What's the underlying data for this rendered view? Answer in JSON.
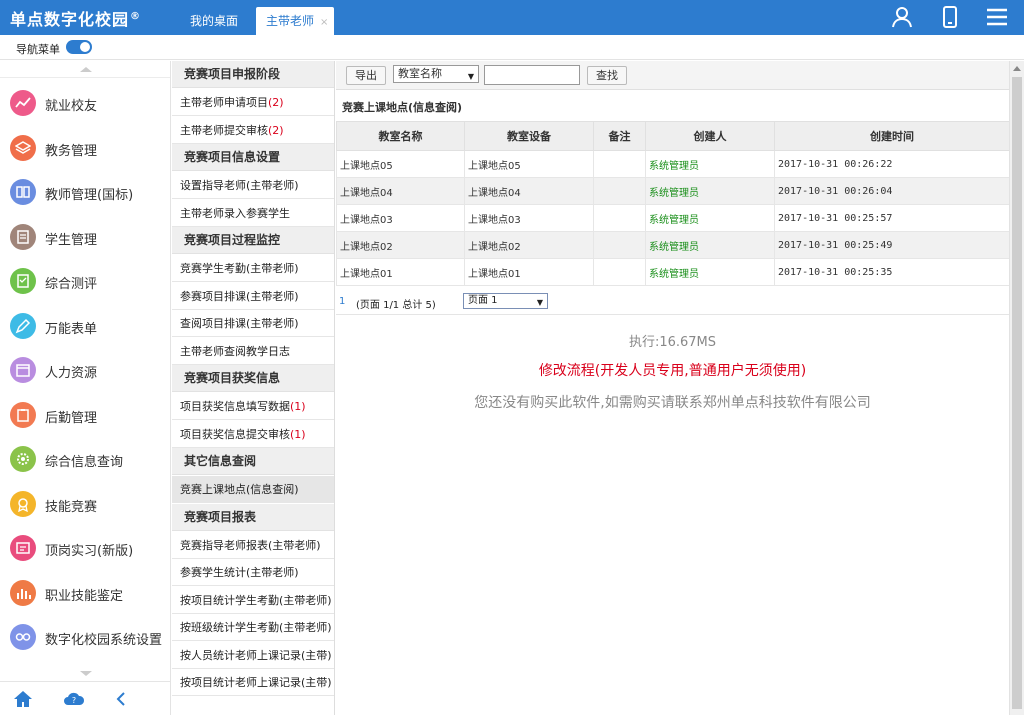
{
  "app": {
    "title": "单点数字化校园",
    "reg_mark": "®"
  },
  "tabs": [
    {
      "label": "我的桌面"
    },
    {
      "label": "主带老师",
      "close": "×"
    }
  ],
  "nav_toggle": {
    "label": "导航菜单",
    "state": "on"
  },
  "sidebar": {
    "items": [
      {
        "label": "就业校友",
        "icon": "trend-line-icon",
        "color": "#ee5a8a"
      },
      {
        "label": "教务管理",
        "icon": "layers-icon",
        "color": "#f06e4a"
      },
      {
        "label": "教师管理(国标)",
        "icon": "book-icon",
        "color": "#6a8de0"
      },
      {
        "label": "学生管理",
        "icon": "document-list-icon",
        "color": "#a0857a"
      },
      {
        "label": "综合测评",
        "icon": "checklist-icon",
        "color": "#6ec24a"
      },
      {
        "label": "万能表单",
        "icon": "form-edit-icon",
        "color": "#3ebbe6"
      },
      {
        "label": "人力资源",
        "icon": "calendar-icon",
        "color": "#b98de0"
      },
      {
        "label": "后勤管理",
        "icon": "clipboard-icon",
        "color": "#f27a52"
      },
      {
        "label": "综合信息查询",
        "icon": "gear-icon",
        "color": "#8bc34a"
      },
      {
        "label": "技能竞赛",
        "icon": "badge-icon",
        "color": "#f4b52a"
      },
      {
        "label": "顶岗实习(新版)",
        "icon": "id-card-icon",
        "color": "#e94c7d"
      },
      {
        "label": "职业技能鉴定",
        "icon": "bar-chart-icon",
        "color": "#ef7a45"
      },
      {
        "label": "数字化校园系统设置",
        "icon": "glasses-icon",
        "color": "#7f93e8"
      }
    ],
    "bottom": {
      "home_icon": "home-icon",
      "cloud_icon": "cloud-help-icon",
      "collapse_icon": "chevron-left-icon"
    }
  },
  "submenu": {
    "groups": [
      {
        "title": "竞赛项目申报阶段",
        "items": [
          {
            "label": "主带老师申请项目",
            "count": "(2)"
          },
          {
            "label": "主带老师提交审核",
            "count": "(2)"
          }
        ]
      },
      {
        "title": "竞赛项目信息设置",
        "items": [
          {
            "label": "设置指导老师(主带老师)"
          },
          {
            "label": "主带老师录入参赛学生"
          }
        ]
      },
      {
        "title": "竞赛项目过程监控",
        "items": [
          {
            "label": "竞赛学生考勤(主带老师)"
          },
          {
            "label": "参赛项目排课(主带老师)"
          },
          {
            "label": "查阅项目排课(主带老师)"
          },
          {
            "label": "主带老师查阅教学日志"
          }
        ]
      },
      {
        "title": "竞赛项目获奖信息",
        "items": [
          {
            "label": "项目获奖信息填写数据",
            "count": "(1)"
          },
          {
            "label": "项目获奖信息提交审核",
            "count": "(1)"
          }
        ]
      },
      {
        "title": "其它信息查阅",
        "items": [
          {
            "label": "竞赛上课地点(信息查阅)",
            "selected": true
          }
        ]
      },
      {
        "title": "竞赛项目报表",
        "items": [
          {
            "label": "竞赛指导老师报表(主带老师)"
          },
          {
            "label": "参赛学生统计(主带老师)"
          },
          {
            "label": "按项目统计学生考勤(主带老师)"
          },
          {
            "label": "按班级统计学生考勤(主带老师)"
          },
          {
            "label": "按人员统计老师上课记录(主带)"
          },
          {
            "label": "按项目统计老师上课记录(主带)"
          }
        ]
      }
    ]
  },
  "toolbar": {
    "export_label": "导出",
    "field_select": "教室名称",
    "search_value": "",
    "search_label": "查找"
  },
  "section_title": "竞赛上课地点(信息查阅)",
  "table": {
    "headers": [
      "教室名称",
      "教室设备",
      "备注",
      "创建人",
      "创建时间"
    ],
    "rows": [
      [
        "上课地点05",
        "上课地点05",
        "",
        "系统管理员",
        "2017-10-31 00:26:22"
      ],
      [
        "上课地点04",
        "上课地点04",
        "",
        "系统管理员",
        "2017-10-31 00:26:04"
      ],
      [
        "上课地点03",
        "上课地点03",
        "",
        "系统管理员",
        "2017-10-31 00:25:57"
      ],
      [
        "上课地点02",
        "上课地点02",
        "",
        "系统管理员",
        "2017-10-31 00:25:49"
      ],
      [
        "上课地点01",
        "上课地点01",
        "",
        "系统管理员",
        "2017-10-31 00:25:35"
      ]
    ]
  },
  "pager": {
    "current": "1",
    "info": "(页面 1/1  总计 5)",
    "page_select": "页面 1"
  },
  "footer": {
    "exec_time": "执行:16.67MS",
    "dev_link": "修改流程(开发人员专用,普通用户无须使用)",
    "notice": "您还没有购买此软件,如需购买请联系郑州单点科技软件有限公司"
  }
}
